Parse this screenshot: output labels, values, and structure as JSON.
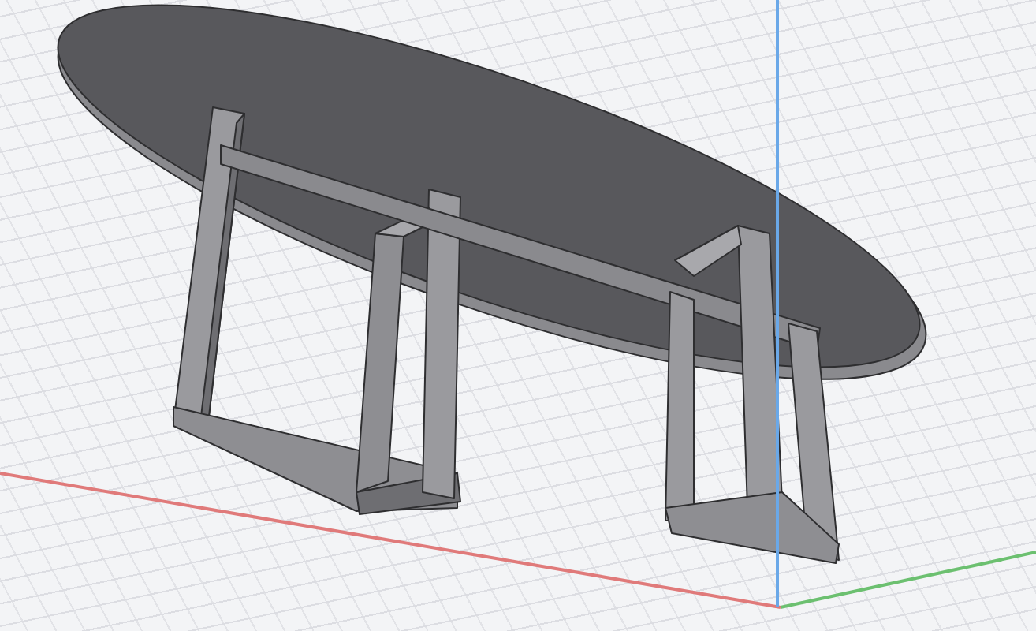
{
  "axes": [
    {
      "color": "#e07a7a"
    },
    {
      "color": "#6cc070"
    },
    {
      "color": "#6aa8e8"
    }
  ]
}
